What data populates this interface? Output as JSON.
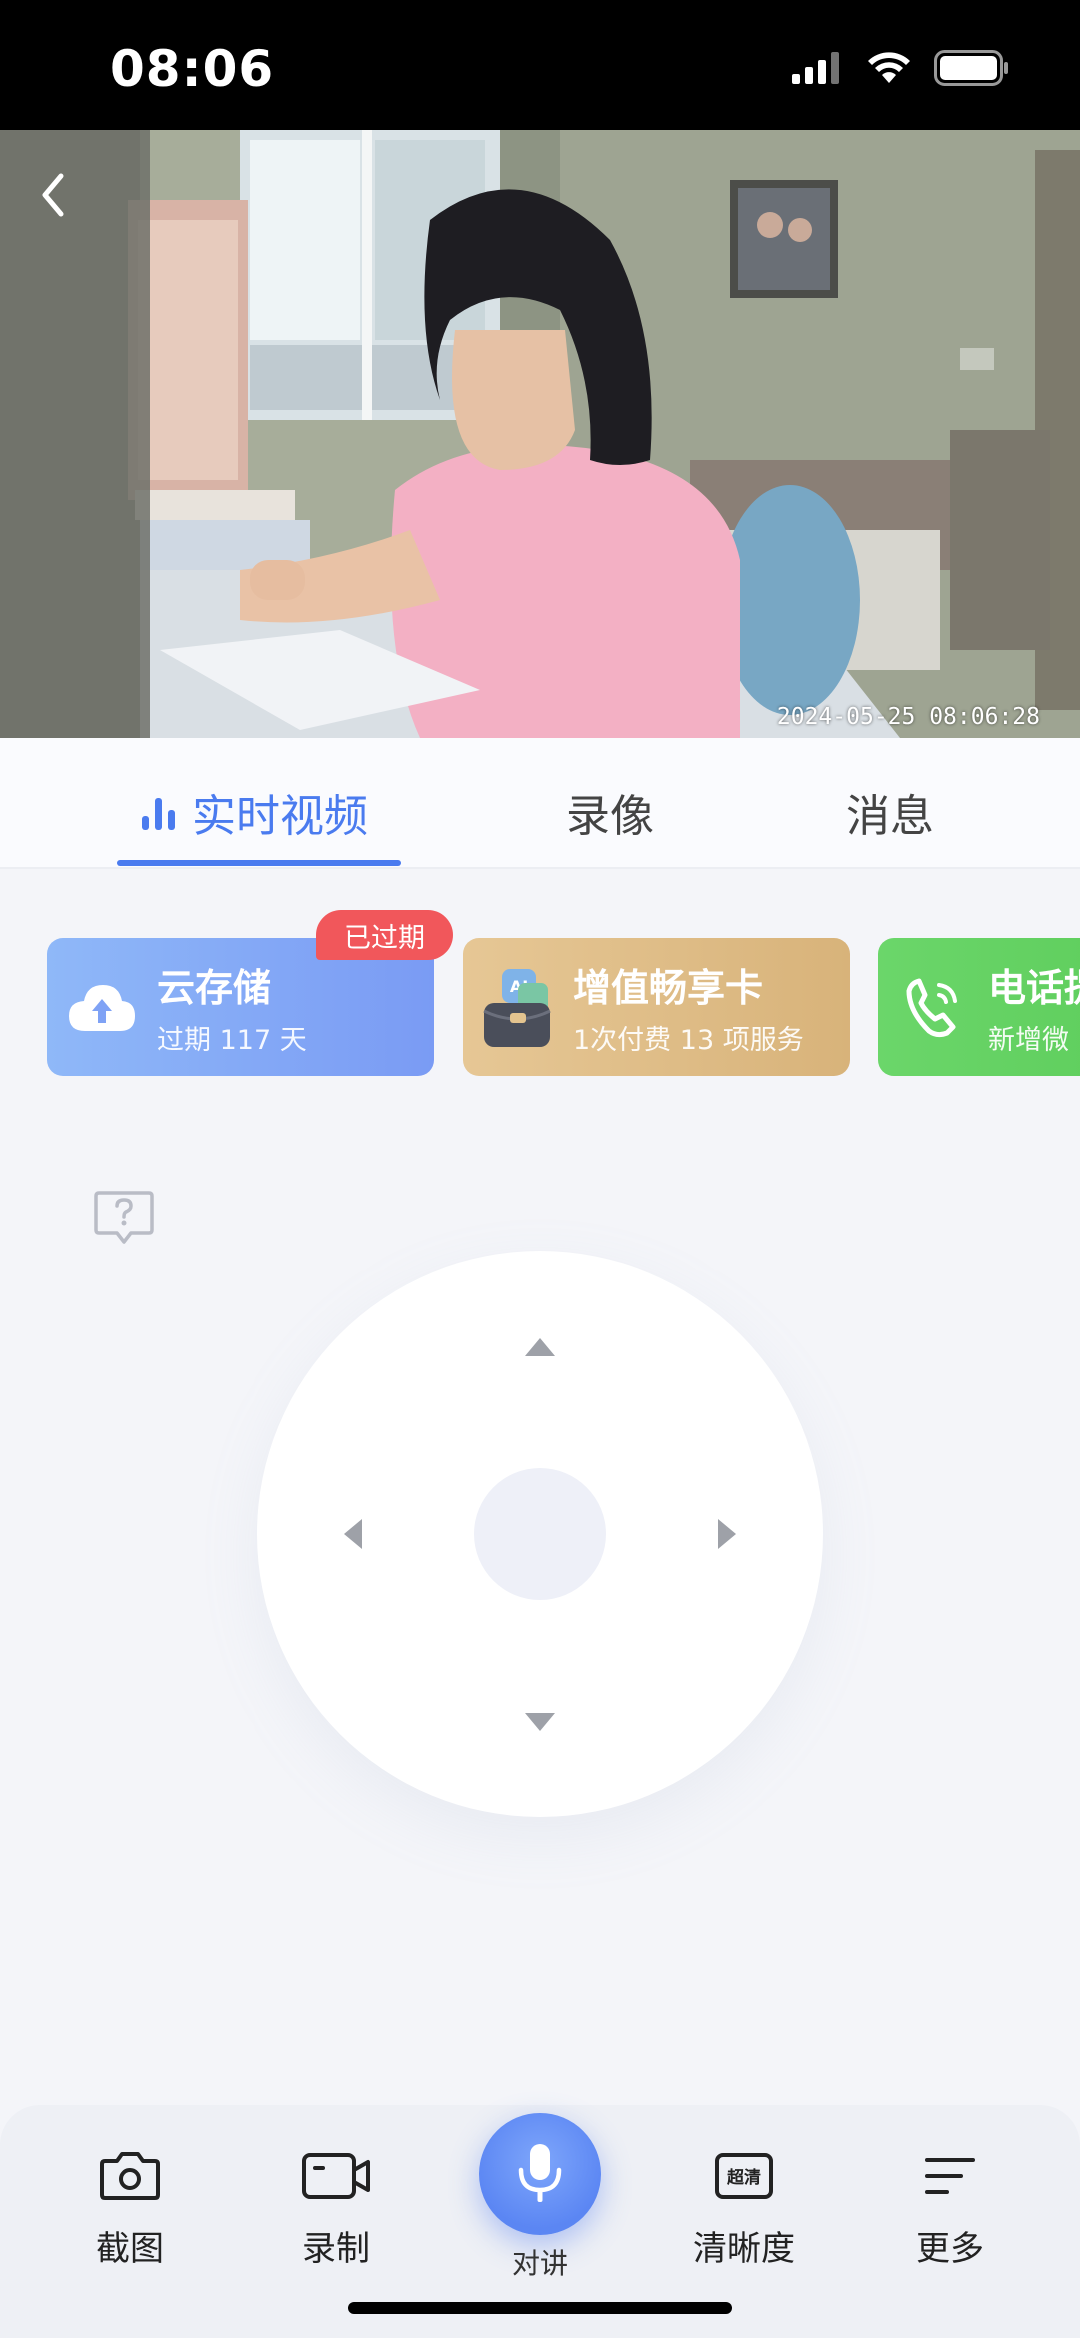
{
  "status_bar": {
    "time": "08:06"
  },
  "video": {
    "timestamp": "2024-05-25 08:06:28"
  },
  "tabs": [
    {
      "label": "实时视频",
      "active": true
    },
    {
      "label": "录像",
      "active": false
    },
    {
      "label": "消息",
      "active": false
    }
  ],
  "cards": {
    "cloud": {
      "title": "云存储",
      "subtitle": "过期 117 天",
      "badge": "已过期"
    },
    "vip": {
      "title": "增值畅享卡",
      "subtitle": "1次付费 13 项服务"
    },
    "phone": {
      "title": "电话提",
      "subtitle": "新增微"
    }
  },
  "toolbar": {
    "screenshot": "截图",
    "record": "录制",
    "talk": "对讲",
    "quality": "清晰度",
    "quality_icon_text": "超清",
    "more": "更多"
  },
  "colors": {
    "accent": "#4a7bef",
    "badge": "#f1575b",
    "cloud_card": "#7a9bf4",
    "vip_card": "#d8b37a",
    "phone_card": "#5ccc5a"
  }
}
